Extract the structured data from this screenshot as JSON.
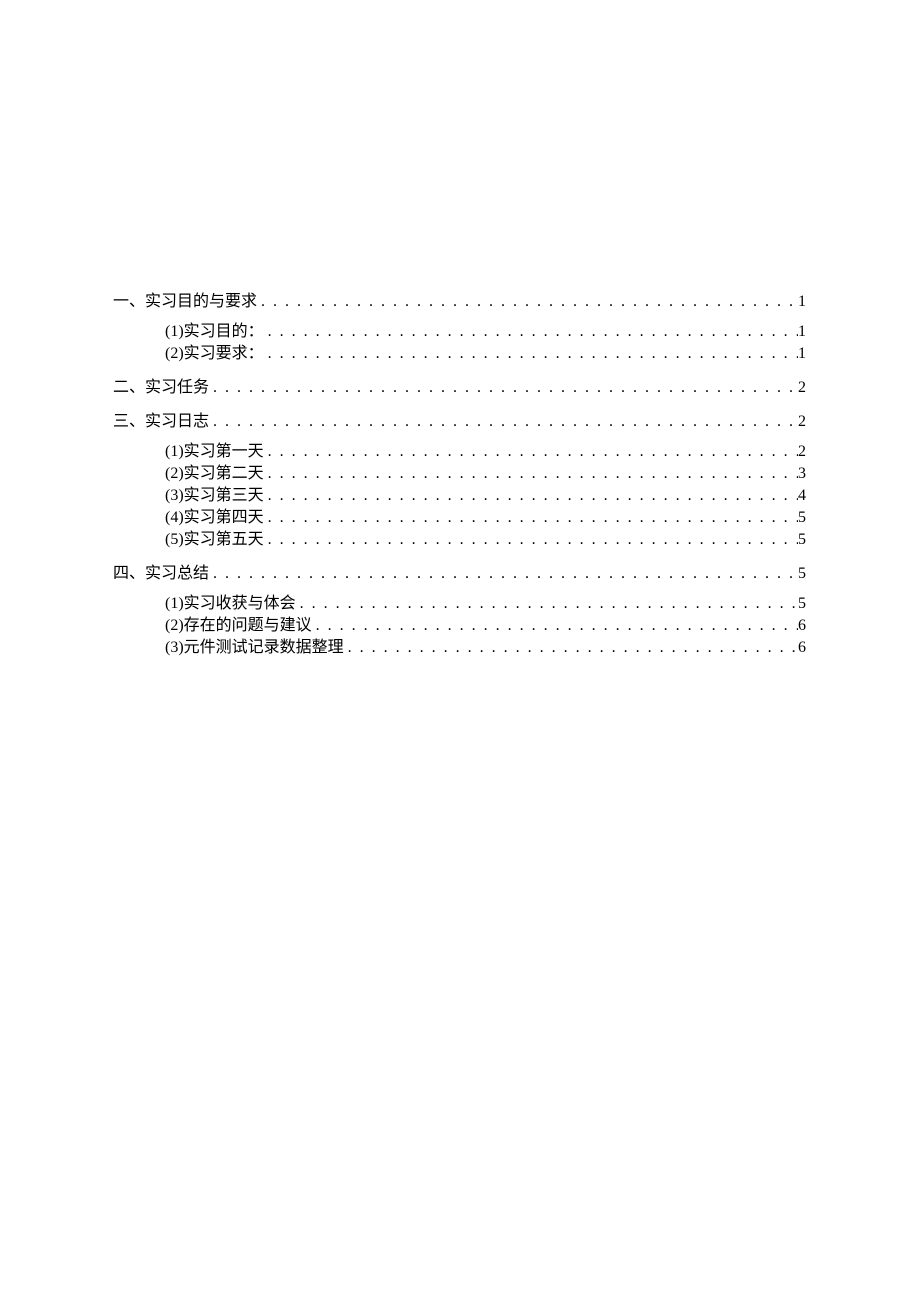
{
  "toc": {
    "sections": [
      {
        "title": "一、实习目的与要求",
        "page": "1",
        "children": [
          {
            "title": "(1)实习目的：",
            "page": "1"
          },
          {
            "title": "(2)实习要求：",
            "page": "1"
          }
        ]
      },
      {
        "title": "二、实习任务",
        "page": "2",
        "children": []
      },
      {
        "title": "三、实习日志",
        "page": "2",
        "children": [
          {
            "title": "(1)实习第一天",
            "page": "2"
          },
          {
            "title": "(2)实习第二天",
            "page": "3"
          },
          {
            "title": "(3)实习第三天",
            "page": "4"
          },
          {
            "title": "(4)实习第四天",
            "page": "5"
          },
          {
            "title": "(5)实习第五天",
            "page": "5"
          }
        ]
      },
      {
        "title": "四、实习总结",
        "page": "5",
        "children": [
          {
            "title": "(1)实习收获与体会",
            "page": "5"
          },
          {
            "title": "(2)存在的问题与建议",
            "page": "6"
          },
          {
            "title": "(3)元件测试记录数据整理",
            "page": "6"
          }
        ]
      }
    ]
  }
}
